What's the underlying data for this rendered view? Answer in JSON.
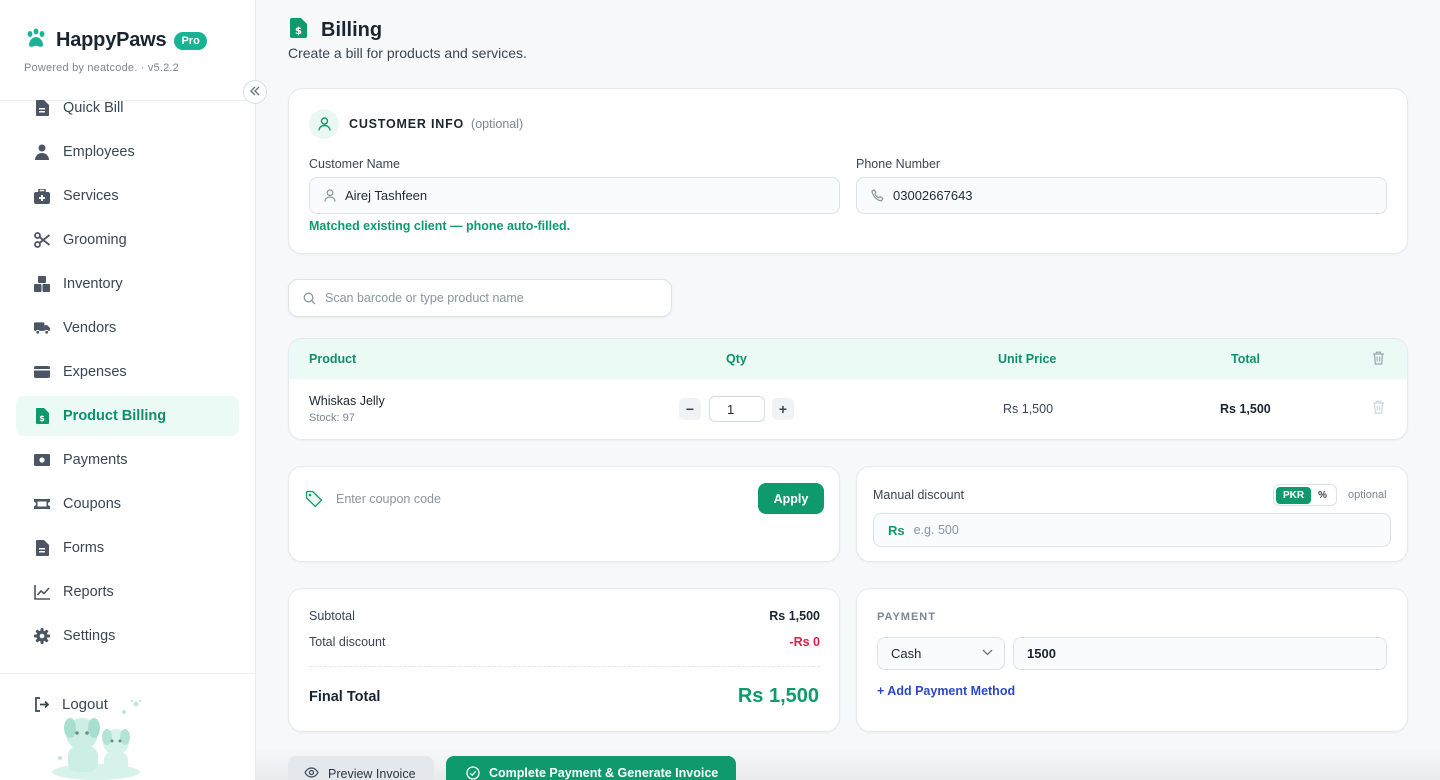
{
  "brand": {
    "name": "HappyPaws",
    "badge": "Pro",
    "powered": "Powered by neatcode. · v5.2.2"
  },
  "colors": {
    "accent": "#0f9a6e",
    "brand": "#18b394",
    "danger": "#e11d48",
    "link": "#2c48c9"
  },
  "sidebar": {
    "items": [
      {
        "label": "Quick Bill",
        "icon": "document-icon"
      },
      {
        "label": "Employees",
        "icon": "user-icon"
      },
      {
        "label": "Services",
        "icon": "medkit-icon"
      },
      {
        "label": "Grooming",
        "icon": "scissors-icon"
      },
      {
        "label": "Inventory",
        "icon": "boxes-icon"
      },
      {
        "label": "Vendors",
        "icon": "truck-icon"
      },
      {
        "label": "Expenses",
        "icon": "wallet-icon"
      },
      {
        "label": "Product Billing",
        "icon": "invoice-icon",
        "active": true
      },
      {
        "label": "Payments",
        "icon": "cash-icon"
      },
      {
        "label": "Coupons",
        "icon": "ticket-icon"
      },
      {
        "label": "Forms",
        "icon": "form-icon"
      },
      {
        "label": "Reports",
        "icon": "chart-line-icon"
      },
      {
        "label": "Settings",
        "icon": "gear-icon"
      }
    ],
    "logout": "Logout"
  },
  "page": {
    "title": "Billing",
    "subtitle": "Create a bill for products and services."
  },
  "customer": {
    "title": "CUSTOMER INFO",
    "optional": "(optional)",
    "name_label": "Customer Name",
    "name_value": "Airej Tashfeen",
    "phone_label": "Phone Number",
    "phone_value": "03002667643",
    "match_note": "Matched existing client — phone auto-filled."
  },
  "search": {
    "placeholder": "Scan barcode or type product name"
  },
  "table": {
    "headers": {
      "product": "Product",
      "qty": "Qty",
      "unit_price": "Unit Price",
      "total": "Total"
    },
    "rows": [
      {
        "name": "Whiskas Jelly",
        "stock": "Stock: 97",
        "qty": "1",
        "unit_price": "Rs 1,500",
        "total": "Rs 1,500"
      }
    ]
  },
  "coupon": {
    "placeholder": "Enter coupon code",
    "apply": "Apply"
  },
  "discount": {
    "label": "Manual discount",
    "mode_pkr": "PKR",
    "mode_percent": "%",
    "optional": "optional",
    "prefix": "Rs",
    "placeholder": "e.g. 500"
  },
  "summary": {
    "subtotal_label": "Subtotal",
    "subtotal": "Rs 1,500",
    "discount_label": "Total discount",
    "discount": "-Rs 0",
    "final_label": "Final Total",
    "final": "Rs 1,500"
  },
  "payment": {
    "title": "PAYMENT",
    "method": "Cash",
    "amount": "1500",
    "add_method": "+ Add Payment Method"
  },
  "actions": {
    "preview": "Preview Invoice",
    "complete": "Complete Payment & Generate Invoice"
  }
}
